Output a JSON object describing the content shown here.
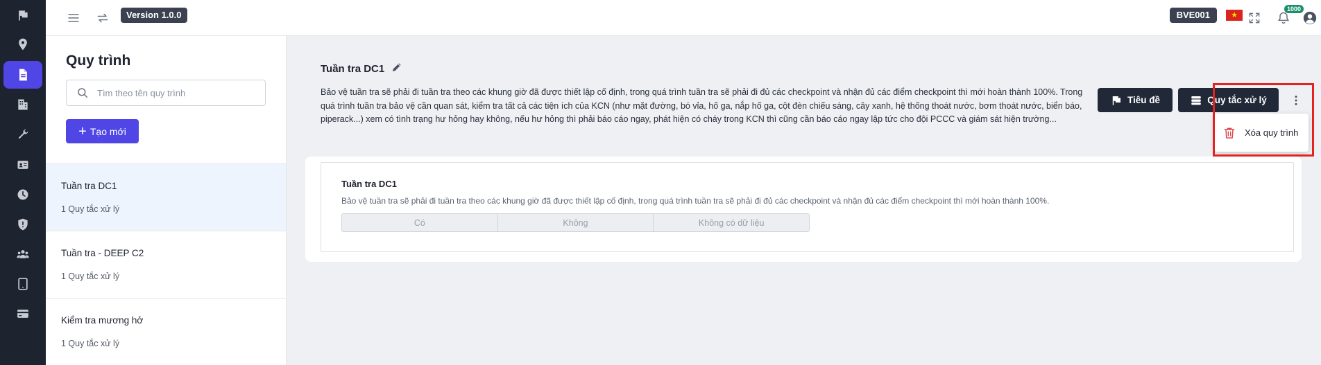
{
  "header": {
    "version": "Version 1.0.0",
    "code": "BVE001",
    "flag_star": "★",
    "notification_count": "1000"
  },
  "sidebar_icons": [
    "flag-icon",
    "location-pin-icon",
    "document-icon",
    "building-icon",
    "wrench-icon",
    "id-card-icon",
    "clock-icon",
    "shield-icon",
    "users-icon",
    "tablet-icon",
    "card-icon"
  ],
  "list": {
    "title": "Quy trình",
    "search_placeholder": "Tìm theo tên quy trình",
    "create_label": "Tạo mới",
    "items": [
      {
        "name": "Tuần tra DC1",
        "sub": "1 Quy tắc xử lý"
      },
      {
        "name": "Tuần tra - DEEP C2",
        "sub": "1 Quy tắc xử lý"
      },
      {
        "name": "Kiểm tra mương hở",
        "sub": "1 Quy tắc xử lý"
      }
    ]
  },
  "detail": {
    "title": "Tuần tra DC1",
    "description": "Bảo vệ tuần tra sẽ phải đi tuần tra theo các khung giờ đã được thiết lập cố định, trong quá trình tuần tra sẽ phải đi đủ các checkpoint và nhận đủ các điểm checkpoint thì mới hoàn thành 100%. Trong quá trình tuần tra bảo vệ cần quan sát, kiểm tra tất cả các tiện ích của KCN (như mặt đường, bó vỉa, hố ga, nắp hố ga, cột đèn chiếu sáng, cây xanh, hệ thống thoát nước, bơm thoát nước, biển báo, piperack...) xem có tình trạng hư hỏng hay không, nếu hư hỏng thì phải báo cáo ngay, phát hiện có cháy trong KCN thì cũng cần báo cáo ngay lập tức cho đội PCCC và giám sát hiện trường...",
    "btn_title": "Tiêu đề",
    "btn_rules": "Quy tắc xử lý",
    "menu_delete": "Xóa quy trình"
  },
  "card": {
    "title": "Tuần tra DC1",
    "description": "Bảo vệ tuần tra sẽ phải đi tuần tra theo các khung giờ đã được thiết lập cố định, trong quá trình tuần tra sẽ phải đi đủ các checkpoint và nhận đủ các điểm checkpoint thì mới hoàn thành 100%.",
    "options": [
      "Có",
      "Không",
      "Không có dữ liệu"
    ]
  },
  "colors": {
    "rail_bg": "#1e2330",
    "accent": "#4f46e5",
    "dark_button": "#212838",
    "highlight": "#e42320"
  }
}
